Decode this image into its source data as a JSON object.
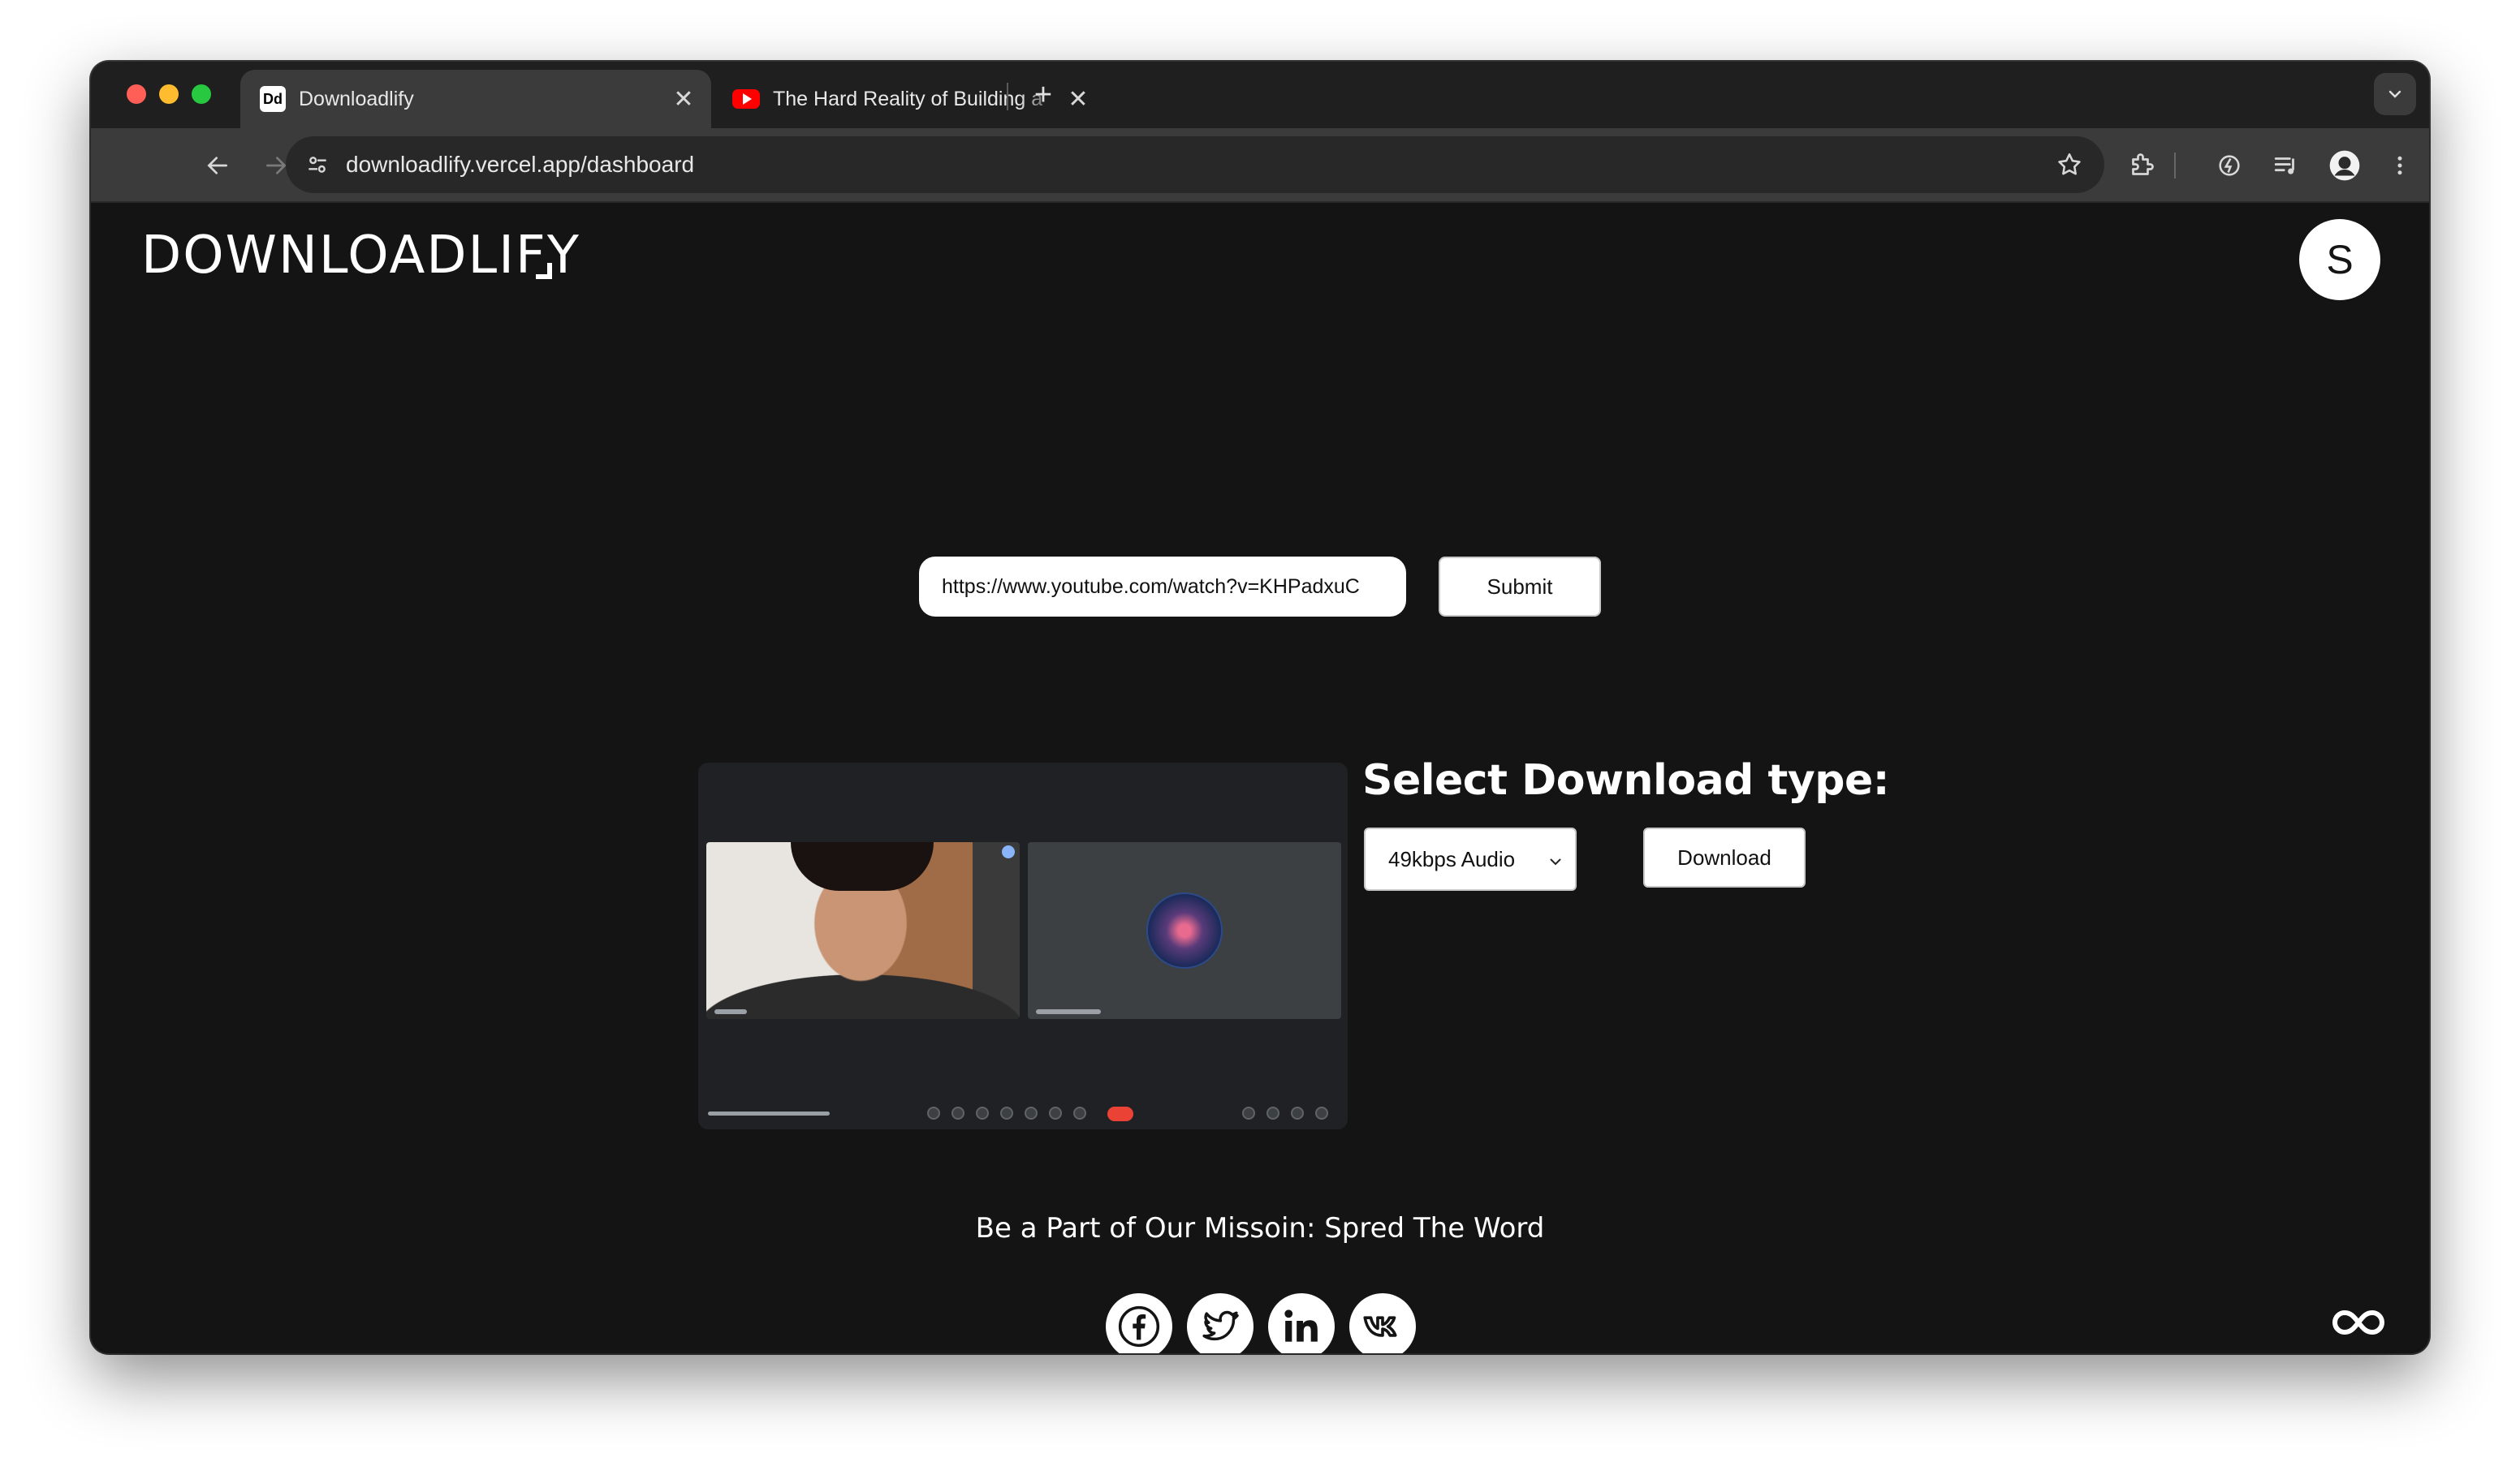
{
  "browser": {
    "tabs": [
      {
        "title": "Downloadlify",
        "favicon": "Dd",
        "active": true
      },
      {
        "title": "The Hard Reality of Building a",
        "favicon": "youtube-icon",
        "active": false
      }
    ],
    "address": "downloadlify.vercel.app/dashboard"
  },
  "header": {
    "logo": "DOWNLOADLIFY",
    "avatar_initial": "S"
  },
  "form": {
    "url_value": "https://www.youtube.com/watch?v=KHPadxuC",
    "submit_label": "Submit"
  },
  "download": {
    "title": "Select Download type:",
    "selected_option": "49kbps Audio",
    "button_label": "Download"
  },
  "footer": {
    "mission_text": "Be a Part of Our Missoin: Spred The Word",
    "socials": [
      "facebook-icon",
      "twitter-icon",
      "linkedin-icon",
      "vk-icon"
    ]
  },
  "colors": {
    "page_background": "#141414",
    "toolbar": "#3b3b3b",
    "tabstrip": "#1f1f1f",
    "accent_white": "#ffffff"
  }
}
